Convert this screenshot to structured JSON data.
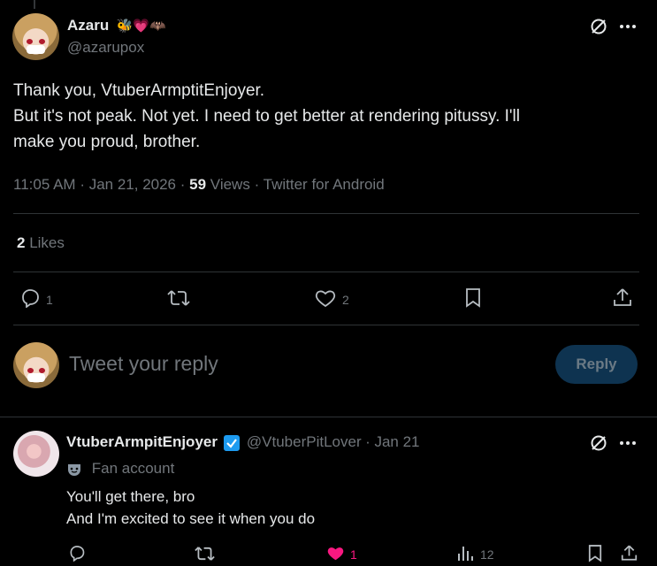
{
  "main_tweet": {
    "name": "Azaru",
    "name_emojis": [
      "bee-icon",
      "heart-icon",
      "bat-icon"
    ],
    "handle": "@azarupox",
    "text_line1": "Thank you, VtuberArmptitEnjoyer.",
    "text_line2": "But it's not peak. Not yet. I need to get better at rendering pitussy. I'll",
    "text_line3": "make you proud, brother.",
    "time": "11:05 AM",
    "date": "Jan 21, 2026",
    "views_count": "59",
    "views_label": "Views",
    "source": "Twitter for Android",
    "likes_count": "2",
    "likes_label": "Likes",
    "actions": {
      "reply_count": "1",
      "retweet_count": "",
      "like_count": "2"
    }
  },
  "reply_box": {
    "placeholder": "Tweet your reply",
    "button_label": "Reply"
  },
  "reply_tweet": {
    "name": "VtuberArmpitEnjoyer",
    "handle": "@VtuberPitLover",
    "date": "Jan 21",
    "label": "Fan account",
    "text_line1": "You'll get there, bro",
    "text_line2": "And I'm excited to see it when you do",
    "actions": {
      "like_count": "1",
      "views_count": "12"
    }
  },
  "colors": {
    "background": "#000000",
    "text": "#e7e9ea",
    "muted": "#71767b",
    "accent": "#1d9bf0",
    "like": "#f91880"
  }
}
